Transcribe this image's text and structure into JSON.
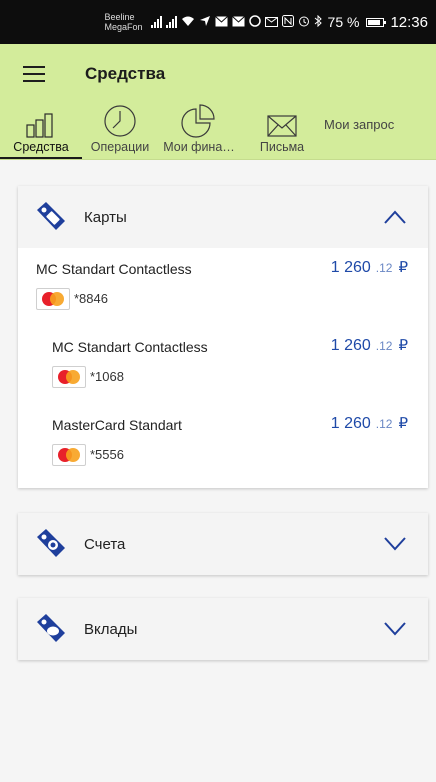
{
  "status_bar": {
    "carrier1": "Beeline",
    "carrier2": "MegaFon",
    "battery": "75 %",
    "time": "12:36"
  },
  "app_bar": {
    "title": "Средства"
  },
  "tabs": [
    {
      "label": "Средства",
      "icon": "bar-chart-icon",
      "active": true
    },
    {
      "label": "Операции",
      "icon": "clock-icon",
      "active": false
    },
    {
      "label": "Мои фина…",
      "icon": "pie-chart-icon",
      "active": false
    },
    {
      "label": "Письма",
      "icon": "envelope-icon",
      "active": false
    },
    {
      "label": "Мои запрос",
      "icon": "",
      "active": false
    }
  ],
  "sections": {
    "cards": {
      "title": "Карты",
      "icon": "card-tag-icon",
      "expanded": true,
      "items": [
        {
          "name": "MC Standart Contactless",
          "amount": "1 260",
          "fraction": ".12",
          "currency": "₽",
          "number": "*8846",
          "brand": "mastercard-logo"
        },
        {
          "name": "MC Standart Contactless",
          "amount": "1 260",
          "fraction": ".12",
          "currency": "₽",
          "number": "*1068",
          "brand": "mastercard-logo"
        },
        {
          "name": "MasterCard Standart",
          "amount": "1 260",
          "fraction": ".12",
          "currency": "₽",
          "number": "*5556",
          "brand": "mastercard-logo"
        }
      ]
    },
    "accounts": {
      "title": "Счета",
      "icon": "account-tag-icon",
      "expanded": false
    },
    "deposits": {
      "title": "Вклады",
      "icon": "piggy-tag-icon",
      "expanded": false
    }
  },
  "colors": {
    "accent_green": "#d3ec9b",
    "amount_blue": "#1f4aa8",
    "icon_blue": "#1f3f9c"
  }
}
